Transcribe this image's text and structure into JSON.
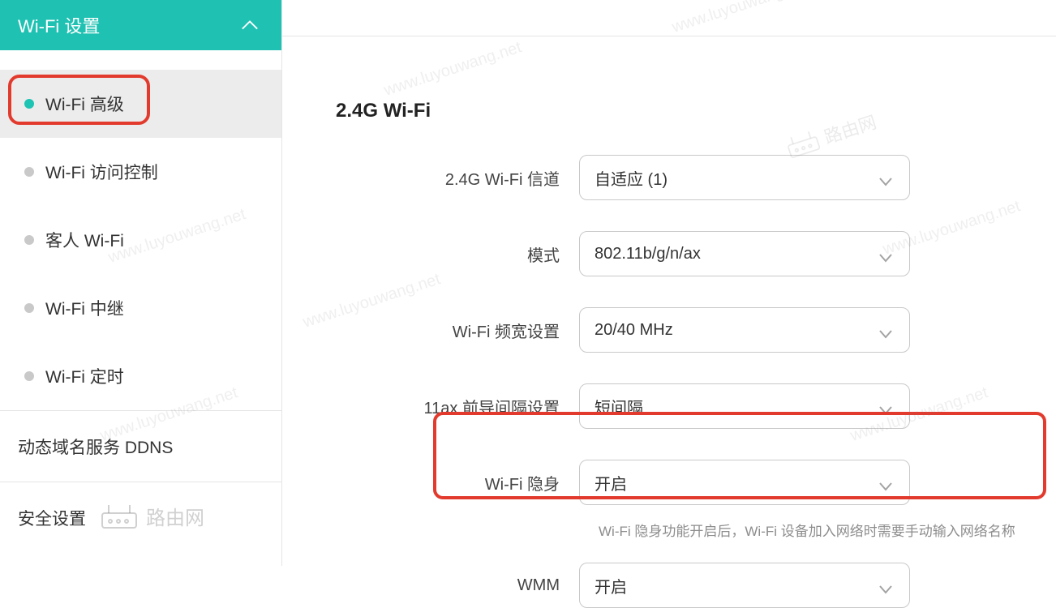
{
  "sidebar": {
    "header": "Wi-Fi 设置",
    "items": [
      {
        "label": "Wi-Fi 高级",
        "active": true
      },
      {
        "label": "Wi-Fi 访问控制",
        "active": false
      },
      {
        "label": "客人 Wi-Fi",
        "active": false
      },
      {
        "label": "Wi-Fi 中继",
        "active": false
      },
      {
        "label": "Wi-Fi 定时",
        "active": false
      }
    ],
    "sections": [
      {
        "label": "动态域名服务 DDNS"
      },
      {
        "label": "安全设置"
      }
    ]
  },
  "main": {
    "section_title": "2.4G Wi-Fi",
    "rows": [
      {
        "label": "2.4G Wi-Fi 信道",
        "value": "自适应 (1)"
      },
      {
        "label": "模式",
        "value": "802.11b/g/n/ax"
      },
      {
        "label": "Wi-Fi 频宽设置",
        "value": "20/40 MHz"
      },
      {
        "label": "11ax 前导间隔设置",
        "value": "短间隔"
      },
      {
        "label": "Wi-Fi 隐身",
        "value": "开启",
        "hint": "Wi-Fi 隐身功能开启后，Wi-Fi 设备加入网络时需要手动输入网络名称"
      },
      {
        "label": "WMM",
        "value": "开启"
      }
    ]
  },
  "watermark": {
    "text": "www.luyouwang.net",
    "brand": "路由网"
  }
}
